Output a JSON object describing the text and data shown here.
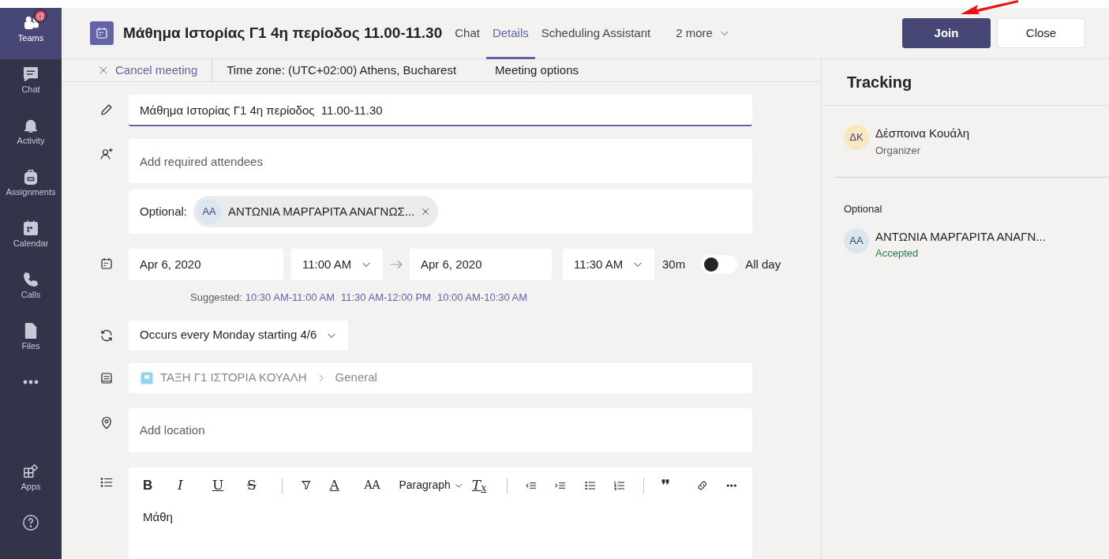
{
  "rail": {
    "items": [
      {
        "kind": "teams",
        "label": "Teams",
        "selected": true,
        "badge": "@"
      },
      {
        "kind": "chat",
        "label": "Chat",
        "selected": false
      },
      {
        "kind": "activity",
        "label": "Activity",
        "selected": false
      },
      {
        "kind": "assignments",
        "label": "Assignments",
        "selected": false
      },
      {
        "kind": "calendar",
        "label": "Calendar",
        "selected": false
      },
      {
        "kind": "calls",
        "label": "Calls",
        "selected": false
      },
      {
        "kind": "files",
        "label": "Files",
        "selected": false
      },
      {
        "kind": "more",
        "selected": false
      }
    ],
    "bottom": [
      {
        "kind": "apps",
        "label": "Apps"
      },
      {
        "kind": "help"
      }
    ]
  },
  "header": {
    "title": "Μάθημα Ιστορίας Γ1 4η περίοδος 11.00-11.30",
    "tabs": [
      {
        "label": "Chat",
        "selected": false
      },
      {
        "label": "Details",
        "selected": true
      },
      {
        "label": "Scheduling Assistant",
        "selected": false
      }
    ],
    "more": "2 more",
    "buttons": [
      {
        "label": "Join",
        "kind": "primary"
      },
      {
        "label": "Close",
        "kind": "default"
      }
    ]
  },
  "toolbar": {
    "cancel": "Cancel meeting",
    "timezone": "Time zone: (UTC+02:00) Athens, Bucharest",
    "options": "Meeting options"
  },
  "form": {
    "title": "Μάθημα Ιστορίας Γ1 4η περίοδος  11.00-11.30",
    "attendees_placeholder": "Add required attendees",
    "optional_label": "Optional:",
    "optional_people": [
      {
        "initials": "AA",
        "name": "ΑΝΤΩΝΙΑ ΜΑΡΓΑΡΙΤΑ ΑΝΑΓΝΩΣ...",
        "color": "#dce6ee"
      }
    ],
    "start_date": "Apr 6, 2020",
    "start_time": "11:00 AM",
    "end_date": "Apr 6, 2020",
    "end_time": "11:30 AM",
    "duration": "30m",
    "all_day": {
      "label": "All day",
      "on": false
    },
    "suggested_label": "Suggested:",
    "suggested": [
      "10:30 AM-11:00 AM",
      "11:30 AM-12:00 PM",
      "10:00 AM-10:30 AM"
    ],
    "recurrence": "Occurs every Monday starting 4/6",
    "channel": {
      "team": "ΤΑΞΗ Γ1 ΙΣΤΟΡΙΑ ΚΟΥΑΛΗ",
      "channel": "General"
    },
    "location_placeholder": "Add location",
    "editor": {
      "tools": [
        {
          "kind": "bold",
          "label": "B"
        },
        {
          "kind": "italic",
          "label": "I"
        },
        {
          "kind": "underline",
          "label": "U"
        },
        {
          "kind": "strike",
          "label": "S"
        },
        {
          "kind": "sep"
        },
        {
          "kind": "highlight"
        },
        {
          "kind": "color",
          "label": "A"
        },
        {
          "kind": "size",
          "label": "AA"
        },
        {
          "kind": "paragraph",
          "label": "Paragraph"
        },
        {
          "kind": "clear",
          "label": "T$_{x}$"
        },
        {
          "kind": "sep"
        },
        {
          "kind": "outdent"
        },
        {
          "kind": "indent"
        },
        {
          "kind": "bullets"
        },
        {
          "kind": "numbered"
        },
        {
          "kind": "sep"
        },
        {
          "kind": "quote",
          "label": "❜❜"
        },
        {
          "kind": "link"
        },
        {
          "kind": "more"
        }
      ],
      "body": "Μάθη"
    }
  },
  "tracking": {
    "title": "Tracking",
    "organizer": {
      "initials": "ΔΚ",
      "name": "Δέσποινα Κουάλη",
      "role": "Organizer",
      "color": "#f7e8c2"
    },
    "optional_title": "Optional",
    "optional": [
      {
        "initials": "AA",
        "name": "ΑΝΤΩΝΙΑ ΜΑΡΓΑΡΙΤΑ ΑΝΑΓΝ...",
        "status": "Accepted",
        "color": "#dce6ee"
      }
    ]
  }
}
